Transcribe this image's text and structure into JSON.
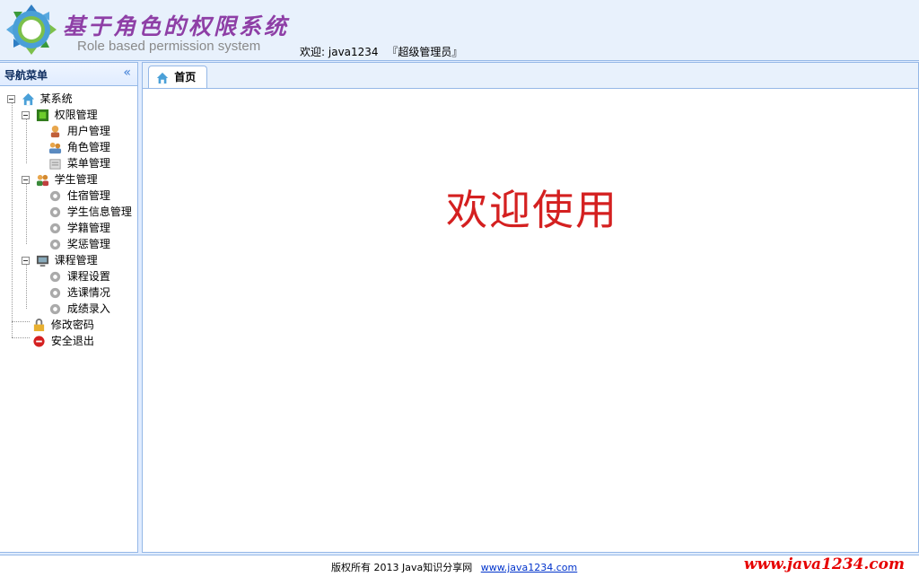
{
  "header": {
    "title": "基于角色的权限系统",
    "subtitle": "Role based permission system",
    "welcome_prefix": "欢迎:",
    "username": "java1234",
    "role": "『超级管理员』"
  },
  "sidebar": {
    "title": "导航菜单",
    "collapse_icon": "«",
    "tree": {
      "root": "某系统",
      "groups": [
        {
          "label": "权限管理",
          "icon": "green-square-icon",
          "items": [
            "用户管理",
            "角色管理",
            "菜单管理"
          ]
        },
        {
          "label": "学生管理",
          "icon": "users-icon",
          "items": [
            "住宿管理",
            "学生信息管理",
            "学籍管理",
            "奖惩管理"
          ]
        },
        {
          "label": "课程管理",
          "icon": "monitor-icon",
          "items": [
            "课程设置",
            "选课情况",
            "成绩录入"
          ]
        }
      ],
      "extra": [
        {
          "label": "修改密码",
          "icon": "lock-icon"
        },
        {
          "label": "安全退出",
          "icon": "exit-icon"
        }
      ]
    }
  },
  "main": {
    "tab_label": "首页",
    "welcome_text": "欢迎使用"
  },
  "footer": {
    "copyright": "版权所有 2013 Java知识分享网",
    "link_text": "www.java1234.com",
    "watermark": "www.java1234.com"
  },
  "colors": {
    "border": "#95b8e7",
    "header_bg": "#e8f1fc",
    "title": "#8e3fa6",
    "welcome": "#d42020"
  }
}
